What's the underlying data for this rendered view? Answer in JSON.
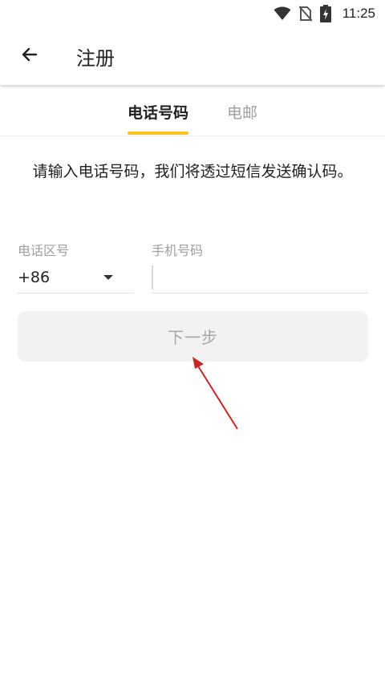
{
  "status_bar": {
    "time": "11:25",
    "icons": [
      "wifi-icon",
      "no-sim-icon",
      "battery-charging-icon"
    ]
  },
  "app_bar": {
    "back_icon": "arrow-left-icon",
    "title": "注册"
  },
  "tabs": [
    {
      "label": "电话号码",
      "active": true
    },
    {
      "label": "电邮",
      "active": false
    }
  ],
  "instruction": "请输入电话号码，我们将透过短信发送确认码。",
  "form": {
    "region_label": "电话区号",
    "region_value": "+86",
    "phone_label": "手机号码",
    "phone_value": "",
    "phone_placeholder": ""
  },
  "next_button": "下一步",
  "colors": {
    "accent": "#f5c518",
    "annotation_arrow": "#c62828",
    "button_bg": "#f2f2f2",
    "button_text": "#a8a8a8"
  }
}
